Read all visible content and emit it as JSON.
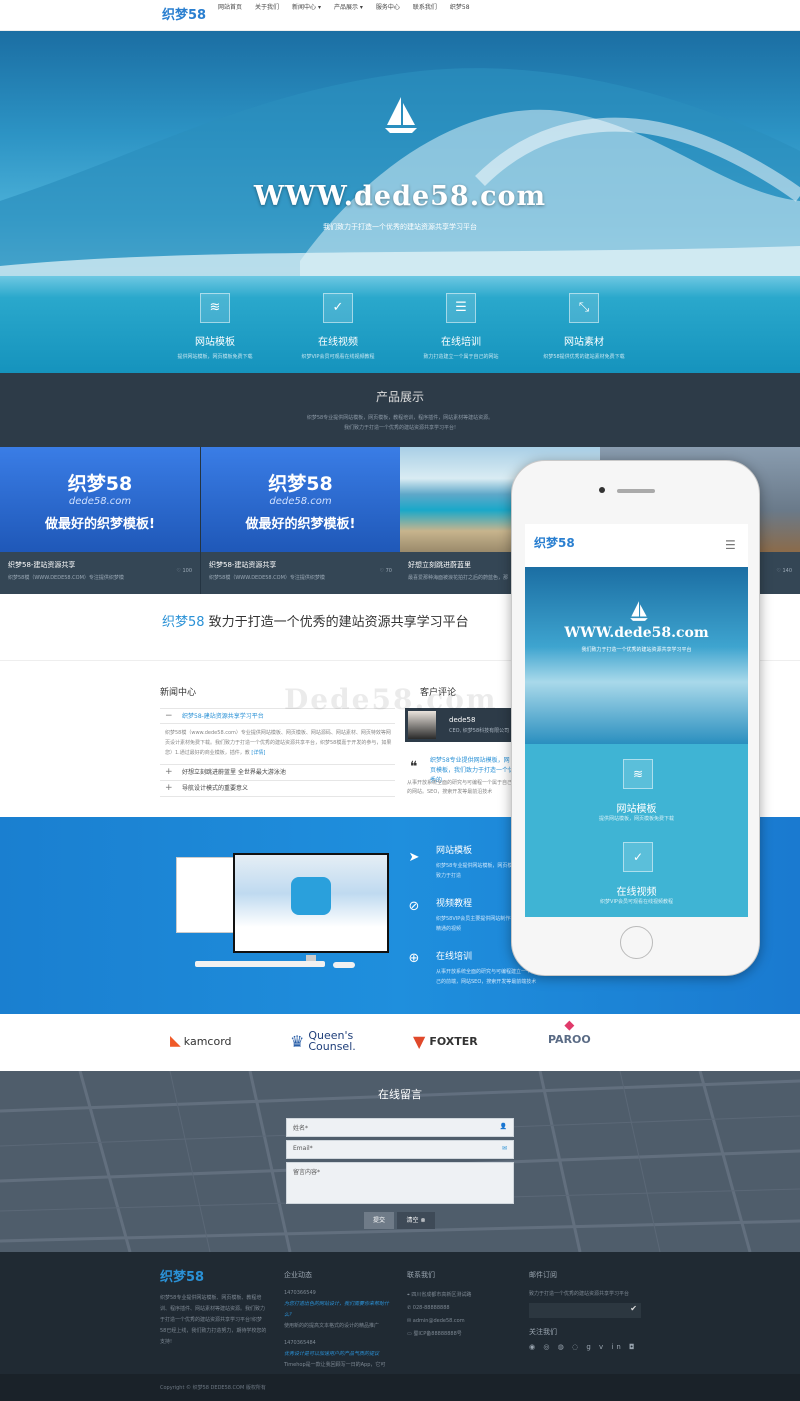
{
  "nav": {
    "logo": "织梦58",
    "items": [
      "网站首页",
      "关于我们",
      "新闻中心 ▾",
      "产品展示 ▾",
      "服务中心",
      "联系我们",
      "织梦58"
    ]
  },
  "hero": {
    "title": "WWW.dede58.com",
    "subtitle": "我们致力于打造一个优秀的建站资源共享学习平台"
  },
  "features": [
    {
      "title": "网站模板",
      "desc": "提供网站模板，网页模板免费下载",
      "icon": "layers-icon"
    },
    {
      "title": "在线视频",
      "desc": "织梦VIP会员可观看在线视频教程",
      "icon": "check-icon"
    },
    {
      "title": "在线培训",
      "desc": "致力打造建立一个属于自己的网站",
      "icon": "list-icon"
    },
    {
      "title": "网站素材",
      "desc": "织梦58提供优秀的建站素材免费下载",
      "icon": "compress-icon"
    }
  ],
  "products": {
    "title": "产品展示",
    "desc1": "织梦58专业提供网站模板，网页模板，教程培训，程序插件，网站素材等建站资源。",
    "desc2": "我们致力于打造一个优秀的建站资源共享学习平台!",
    "cards": [
      {
        "banner1": "织梦58",
        "banner2": "dede58.com",
        "banner3": "做最好的织梦模板!",
        "title": "织梦58-建站资源共享",
        "desc": "织梦58模（WWW.DEDE58.COM）专注提供织梦模",
        "likes": "100"
      },
      {
        "banner1": "织梦58",
        "banner2": "dede58.com",
        "banner3": "做最好的织梦模板!",
        "title": "织梦58-建站资源共享",
        "desc": "织梦58模（WWW.DEDE58.COM）专注提供织梦模",
        "likes": "70"
      },
      {
        "title": "好想立刻跳进蔚蓝里",
        "desc": "最喜爱那种海面被浪花拍打之后的蔚蓝色，那",
        "likes": ""
      },
      {
        "title": "",
        "desc": "",
        "likes": "140"
      }
    ]
  },
  "slogan": {
    "brand": "织梦58",
    "text": " 致力于打造一个优秀的建站资源共享学习平台"
  },
  "news": {
    "heading": "新闻中心",
    "items": [
      {
        "sign": "−",
        "title": "织梦58-建站资源共享学习平台"
      },
      {
        "sign": "+",
        "title": "好想立刻跳进蔚蓝里 全世界最大游泳池"
      },
      {
        "sign": "+",
        "title": "导航设计模式的重要意义"
      }
    ],
    "body": "织梦58模（www.dede58.com）专业提供网站模板、网页模板、网站源码、网站素材、网页特效等网页设计素材免费下载。我们致力于打造一个优秀的建站资源共享平台，织梦58模嘉于开发的参与，如果您）1.通过最好的商业模板，插件，教",
    "more": "[详情]"
  },
  "review": {
    "heading": "客户评论",
    "name": "dede58",
    "role": "CEO, 织梦58科技有限公司",
    "quote": "织梦58专业提供网站模板，网页模板，我们致力于打造一个优秀的",
    "desc": "从事开放系统全面的研究与可编程一个属于自己的网站。SEO，搜索开发等最前沿技术"
  },
  "services": [
    {
      "title": "网站模板",
      "desc": "织梦58专业提供网站模板，网页模板免费下载，我们致力于打造",
      "icon": "paper-plane-icon"
    },
    {
      "title": "视频教程",
      "desc": "织梦58VIP会员主要提供网站制作视频教程，从入门到精通的视频",
      "icon": "compass-icon"
    },
    {
      "title": "在线培训",
      "desc": "从事开放系统全面的研究与可编程建立一个属于自己的前端，网站SEO，搜索开发等最前端技术",
      "icon": "globe-icon"
    }
  ],
  "partners": [
    "kamcord",
    "Queen's Counsel.",
    "FOXTER",
    "PAROO"
  ],
  "message": {
    "heading": "在线留言",
    "name_placeholder": "姓名*",
    "email_placeholder": "Email*",
    "content_placeholder": "留言内容*",
    "submit": "提交",
    "clear": "清空"
  },
  "footer": {
    "logo": "织梦58",
    "about": "织梦58专业提供网站模板、网页模板、教程培训、程序插件、网站素材等建站资源。我们致力于打造一个优秀的建站资源共享学习平台!织梦58已经上线，我们致力打造努力，期待学校您的支持!",
    "news_heading": "企业动态",
    "news": [
      {
        "date": "1470366549",
        "title": "为您打造出色的网站设计，我们需要你来帮助什么?",
        "desc": "使用新的的提高文本格式的设计的精品推广"
      },
      {
        "date": "1470365484",
        "title": "优秀设计是可以加速用户的产品气质的提议",
        "desc": "Timehop是一款让我回顾写一日的App，它可"
      }
    ],
    "contact_heading": "联系我们",
    "contact": [
      "四川省成都市高新区测试路",
      "028-88888888",
      "admin@dede58.com",
      "蜀ICP备88888888号"
    ],
    "subscribe_heading": "邮件订阅",
    "subscribe_desc": "致力于打造一个优秀的建站资源共享学习平台",
    "follow_heading": "关注我们",
    "copyright": "Copyright © 织梦58 DEDE58.COM 版权所有"
  },
  "phone": {
    "logo": "织梦58",
    "hero_title": "WWW.dede58.com",
    "hero_sub": "我们致力于打造一个优秀的建站资源共享学习平台",
    "features": [
      {
        "title": "网站模板",
        "desc": "提供网站模板，网页模板免费下载"
      },
      {
        "title": "在线视频",
        "desc": "织梦VIP会员可观看在线视频教程"
      }
    ]
  },
  "watermark": "Dede58.com",
  "colors": {
    "brand": "#2a7fd0",
    "dark": "#2d3b48",
    "blue": "#1a7fd0",
    "footer": "#202a33"
  }
}
